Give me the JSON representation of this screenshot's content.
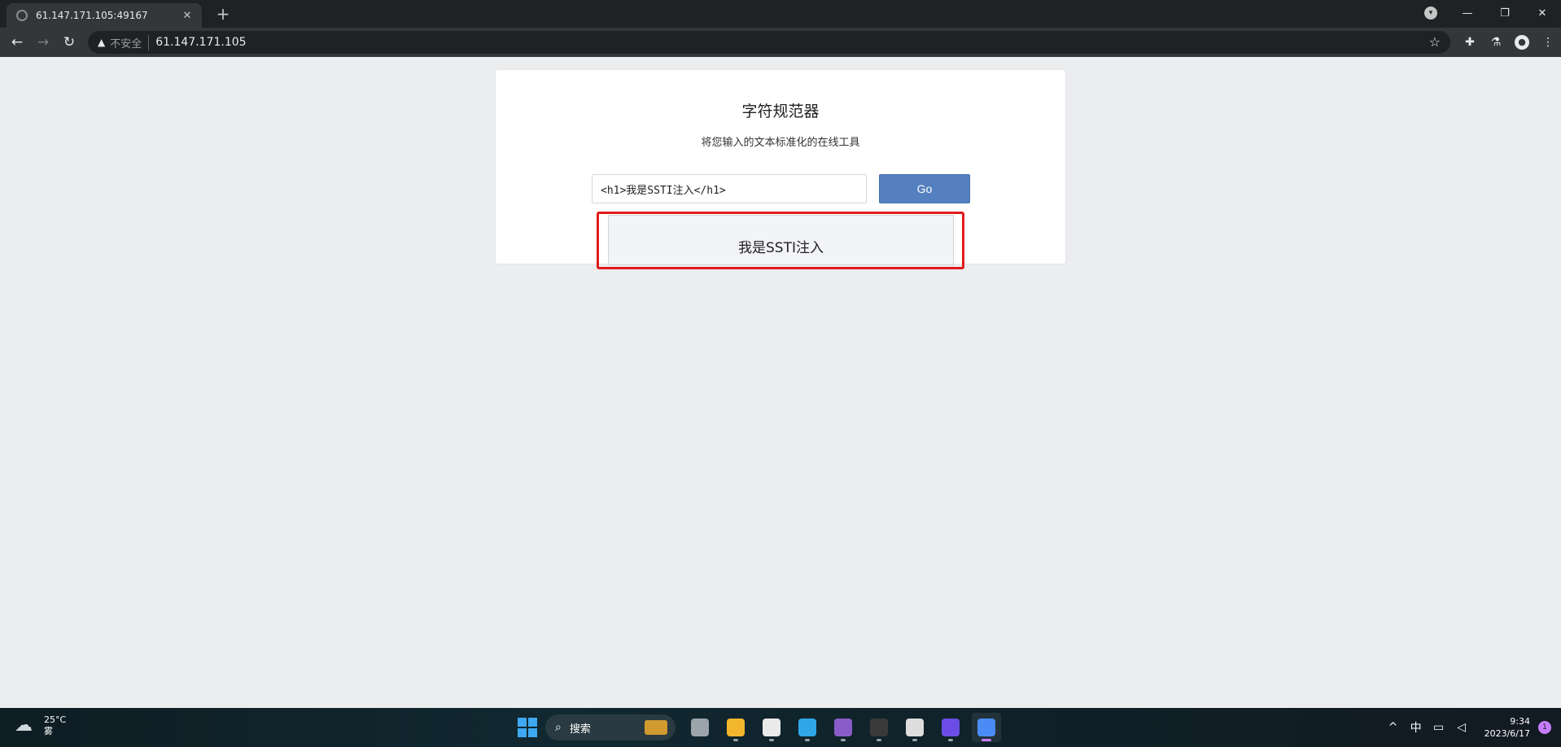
{
  "browser": {
    "tab_title": "61.147.171.105:49167",
    "tab_close": "✕",
    "new_tab": "+",
    "security_label": "不安全",
    "url": "61.147.171.105"
  },
  "page": {
    "title": "字符规范器",
    "subtitle": "将您输入的文本标准化的在线工具",
    "input_value": "<h1>我是SSTI注入</h1>",
    "go_label": "Go",
    "result_text": "我是SSTI注入"
  },
  "taskbar": {
    "temperature": "25°C",
    "weather": "雾",
    "search_label": "搜索",
    "ime": "中",
    "time": "9:34",
    "date": "2023/6/17",
    "notification_count": "1",
    "apps": [
      {
        "name": "task-view-icon",
        "color": "#9aa4aa"
      },
      {
        "name": "file-explorer-icon",
        "color": "#f2b62c"
      },
      {
        "name": "microsoft-store-icon",
        "color": "#eaeaea"
      },
      {
        "name": "edge-icon",
        "color": "#2fa6e8"
      },
      {
        "name": "visual-studio-icon",
        "color": "#8a5cc9"
      },
      {
        "name": "terminal-icon",
        "color": "#3a3a3a"
      },
      {
        "name": "burp-icon",
        "color": "#dddddd"
      },
      {
        "name": "bolt-app-icon",
        "color": "#6b4de6"
      },
      {
        "name": "chrome-icon",
        "color": "#4b8bf5"
      }
    ]
  },
  "colors": {
    "go_button": "#5580bf",
    "highlight": "#e01b1b",
    "page_bg": "#ecedef"
  }
}
